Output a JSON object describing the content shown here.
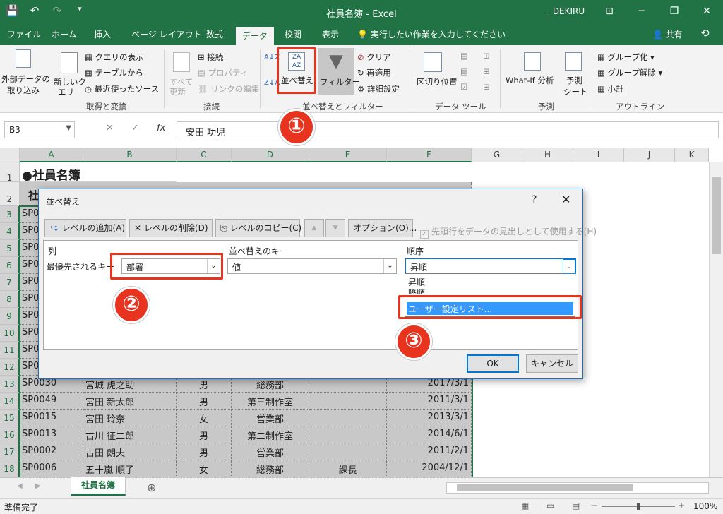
{
  "app": {
    "title": "社員名簿 - Excel",
    "user": "_ DEKIRU",
    "qat": {
      "save_icon": "💾",
      "undo_icon": "↶",
      "redo_icon": "↷",
      "more_icon": "▾"
    },
    "window": {
      "ribbon_icon": "⊡",
      "minimize_icon": "─",
      "restore_icon": "❐",
      "close_icon": "✕"
    }
  },
  "ribbon": {
    "tabs": [
      "ファイル",
      "ホーム",
      "挿入",
      "ページ レイアウト",
      "数式",
      "データ",
      "校閲",
      "表示"
    ],
    "active_tab": "データ",
    "tell_me": "実行したい作業を入力してください",
    "share": "共有",
    "groups": {
      "get_transform": {
        "label": "取得と変換",
        "external_line1": "外部データの",
        "external_line2": "取り込み",
        "new_query_line1": "新しいク",
        "new_query_line2": "エリ",
        "show_queries": "クエリの表示",
        "from_table": "テーブルから",
        "recent_sources": "最近使ったソース"
      },
      "connections": {
        "label": "接続",
        "refresh_line1": "すべて",
        "refresh_line2": "更新",
        "connections": "接続",
        "properties": "プロパティ",
        "edit_links": "リンクの編集"
      },
      "sort_filter": {
        "label": "並べ替えとフィルター",
        "sort": "並べ替え",
        "filter": "フィルター",
        "clear": "クリア",
        "reapply": "再適用",
        "advanced": "詳細設定"
      },
      "data_tools": {
        "label": "データ ツール",
        "text_to_columns": "区切り位置"
      },
      "forecast": {
        "label": "予測",
        "whatif": "What-If 分析",
        "forecast_line1": "予測",
        "forecast_line2": "シート"
      },
      "outline": {
        "label": "アウトライン",
        "group": "グループ化",
        "ungroup": "グループ解除",
        "subtotal": "小計"
      }
    }
  },
  "formula_bar": {
    "name_box": "B3",
    "cancel_icon": "✕",
    "enter_icon": "✓",
    "fx": "fx",
    "value": "安田 功児"
  },
  "callouts": [
    "①",
    "②",
    "③"
  ],
  "sheet": {
    "columns": [
      "A",
      "B",
      "C",
      "D",
      "E",
      "F",
      "G",
      "H",
      "I",
      "J",
      "K"
    ],
    "row_numbers": [
      "1",
      "2",
      "3",
      "4",
      "5",
      "6",
      "7",
      "8",
      "9",
      "10",
      "11",
      "12",
      "13",
      "14",
      "15",
      "16",
      "17",
      "18"
    ],
    "title": "●社員名簿",
    "header_partial": "社",
    "partial_ids": [
      "SP0",
      "SP0",
      "SP0",
      "SP0",
      "SP0",
      "SP0",
      "SP0",
      "SP0",
      "SP0",
      "SP0"
    ],
    "rows": [
      {
        "row": "13",
        "id": "SP0030",
        "name": "宮城 虎之助",
        "gender": "男",
        "dept": "総務部",
        "title": "",
        "date": "2017/3/1"
      },
      {
        "row": "14",
        "id": "SP0049",
        "name": "宮田 新太郎",
        "gender": "男",
        "dept": "第三制作室",
        "title": "",
        "date": "2011/3/1"
      },
      {
        "row": "15",
        "id": "SP0015",
        "name": "宮田 玲奈",
        "gender": "女",
        "dept": "営業部",
        "title": "",
        "date": "2013/3/1"
      },
      {
        "row": "16",
        "id": "SP0013",
        "name": "古川 征二郎",
        "gender": "男",
        "dept": "第二制作室",
        "title": "",
        "date": "2014/6/1"
      },
      {
        "row": "17",
        "id": "SP0002",
        "name": "古田 朗夫",
        "gender": "男",
        "dept": "営業部",
        "title": "",
        "date": "2011/2/1"
      },
      {
        "row": "18",
        "id": "SP0006",
        "name": "五十嵐 順子",
        "gender": "女",
        "dept": "総務部",
        "title": "課長",
        "date": "2004/12/1"
      }
    ],
    "tab_name": "社員名簿",
    "add_sheet_icon": "⊕"
  },
  "dialog": {
    "title": "並べ替え",
    "help": "?",
    "close": "✕",
    "add_level": "レベルの追加(A)",
    "delete_level": "レベルの削除(D)",
    "copy_level": "レベルのコピー(C)",
    "move_up_icon": "▲",
    "move_down_icon": "▼",
    "options": "オプション(O)...",
    "header_checkbox": "先頭行をデータの見出しとして使用する(H)",
    "col_header_column": "列",
    "col_header_key": "並べ替えのキー",
    "col_header_order": "順序",
    "row_label": "最優先されるキー",
    "column_value": "部署",
    "key_value": "値",
    "order_value": "昇順",
    "order_options": [
      "昇順",
      "降順",
      "ユーザー設定リスト..."
    ],
    "ok": "OK",
    "cancel": "キャンセル"
  },
  "status": {
    "ready": "準備完了",
    "zoom": "100%",
    "zoom_minus": "−",
    "zoom_plus": "+"
  }
}
